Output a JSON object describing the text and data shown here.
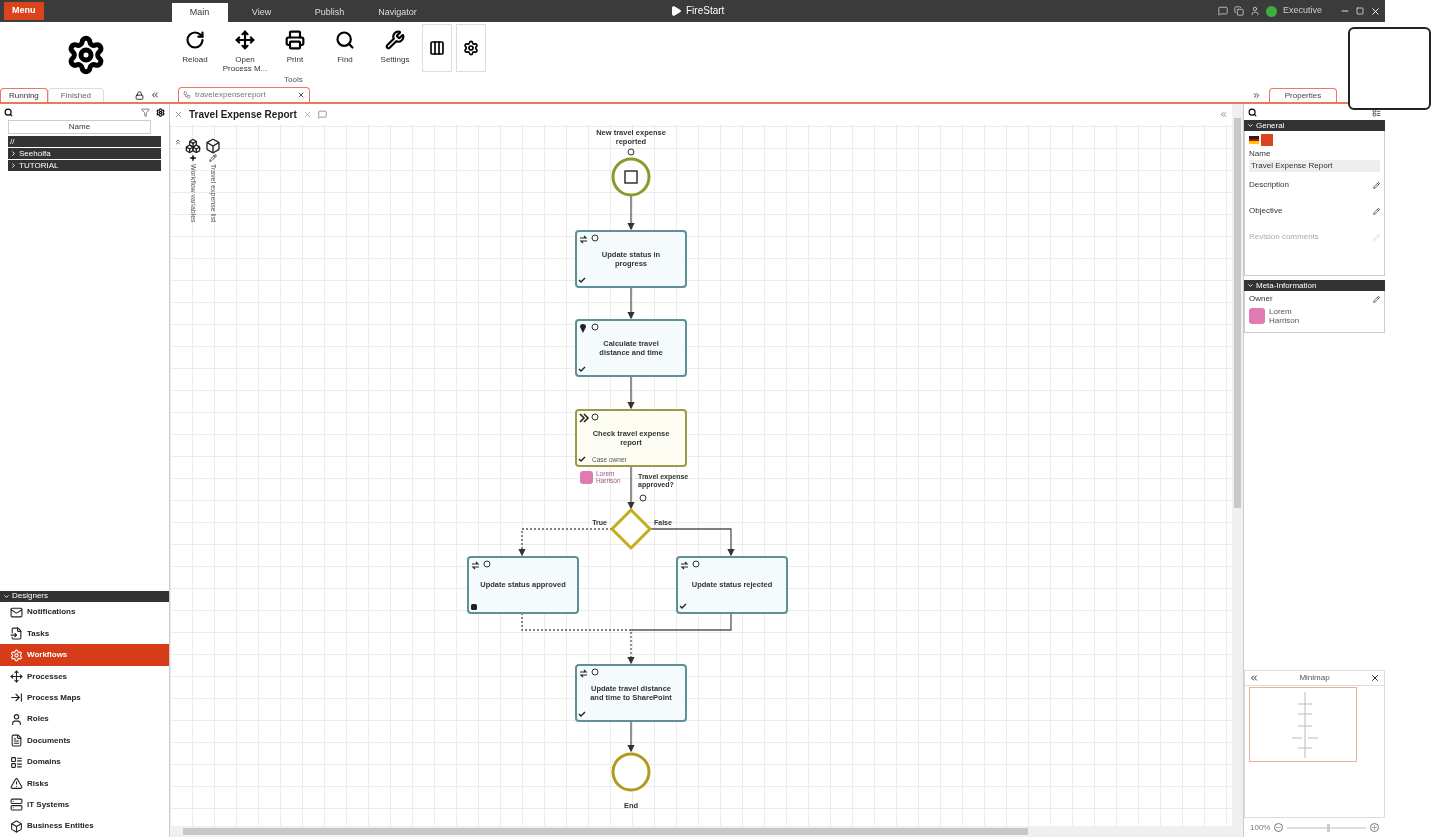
{
  "top_bar": {
    "menu_button": "Menu",
    "tabs": [
      {
        "label": "Main",
        "selected": true
      },
      {
        "label": "View",
        "selected": false
      },
      {
        "label": "Publish",
        "selected": false
      },
      {
        "label": "Navigator",
        "selected": false
      }
    ],
    "app_title": "FireStart",
    "user": "Executive",
    "online": true
  },
  "ribbon": {
    "buttons": [
      {
        "label": "Reload",
        "kind": "reload"
      },
      {
        "label": "Open Process M...",
        "kind": "open"
      },
      {
        "label": "Print",
        "kind": "print"
      },
      {
        "label": "Find",
        "kind": "find"
      },
      {
        "label": "Settings",
        "kind": "settings"
      }
    ],
    "group_label": "Tools",
    "toggles": [
      {
        "kind": "columns"
      },
      {
        "kind": "gear"
      }
    ]
  },
  "left_panel": {
    "tabs": [
      {
        "label": "Running",
        "selected": true
      },
      {
        "label": "Finished",
        "selected": false
      }
    ],
    "column": "Name",
    "tree": [
      {
        "label": "//",
        "kind": "root"
      },
      {
        "label": "Seeholfa",
        "kind": "folder"
      },
      {
        "label": "TUTORIAL",
        "kind": "folder"
      }
    ]
  },
  "designers": {
    "title": "Designers",
    "items": [
      {
        "label": "Notifications",
        "kind": "mail",
        "selected": false
      },
      {
        "label": "Tasks",
        "kind": "task",
        "selected": false
      },
      {
        "label": "Workflows",
        "kind": "workflow",
        "selected": true
      },
      {
        "label": "Processes",
        "kind": "process",
        "selected": false
      },
      {
        "label": "Process Maps",
        "kind": "map",
        "selected": false
      },
      {
        "label": "Roles",
        "kind": "role",
        "selected": false
      },
      {
        "label": "Documents",
        "kind": "document",
        "selected": false
      },
      {
        "label": "Domains",
        "kind": "domain",
        "selected": false
      },
      {
        "label": "Risks",
        "kind": "risk",
        "selected": false
      },
      {
        "label": "IT Systems",
        "kind": "system",
        "selected": false
      },
      {
        "label": "Business Entities",
        "kind": "entity",
        "selected": false
      }
    ]
  },
  "document_tab": {
    "label": "travelexpensereport"
  },
  "canvas": {
    "title": "Travel Expense Report",
    "variables": [
      {
        "label": "Workflow variables",
        "kind": "add"
      },
      {
        "label": "Travel expense list",
        "kind": "edit"
      }
    ],
    "nodes": [
      {
        "kind": "start_event",
        "label": "New travel expense reported"
      },
      {
        "kind": "service_task",
        "label": "Update status in progress",
        "stopped": false
      },
      {
        "kind": "location_task",
        "label": "Calculate travel distance and time",
        "stopped": false
      },
      {
        "kind": "user_task",
        "label": "Check travel expense report",
        "stopped": false,
        "role": "Case owner",
        "assignee": "Lorem Harrison"
      },
      {
        "kind": "gateway",
        "label": "Travel expense approved?",
        "branches": [
          {
            "label": "True",
            "dashed": true
          },
          {
            "label": "False",
            "dashed": false
          }
        ]
      },
      {
        "kind": "service_task",
        "label": "Update status approved",
        "stopped": true
      },
      {
        "kind": "service_task",
        "label": "Update status rejected",
        "stopped": false
      },
      {
        "kind": "service_task",
        "label": "Update travel distance and time to SharePoint",
        "stopped": false
      },
      {
        "kind": "end_event",
        "label": "End"
      }
    ]
  },
  "properties": {
    "tab": "Properties",
    "general": {
      "title": "General",
      "name_label": "Name",
      "name_value": "Travel Expense Report",
      "fields": [
        {
          "label": "Description",
          "disabled": false
        },
        {
          "label": "Objective",
          "disabled": false
        },
        {
          "label": "Revision comments",
          "disabled": true
        }
      ]
    },
    "meta": {
      "title": "Meta-Information",
      "owner_label": "Owner",
      "owner": "Lorem Harrison"
    }
  },
  "minimap": {
    "title": "Minimap",
    "zoom": "100%",
    "level": 0.5
  }
}
